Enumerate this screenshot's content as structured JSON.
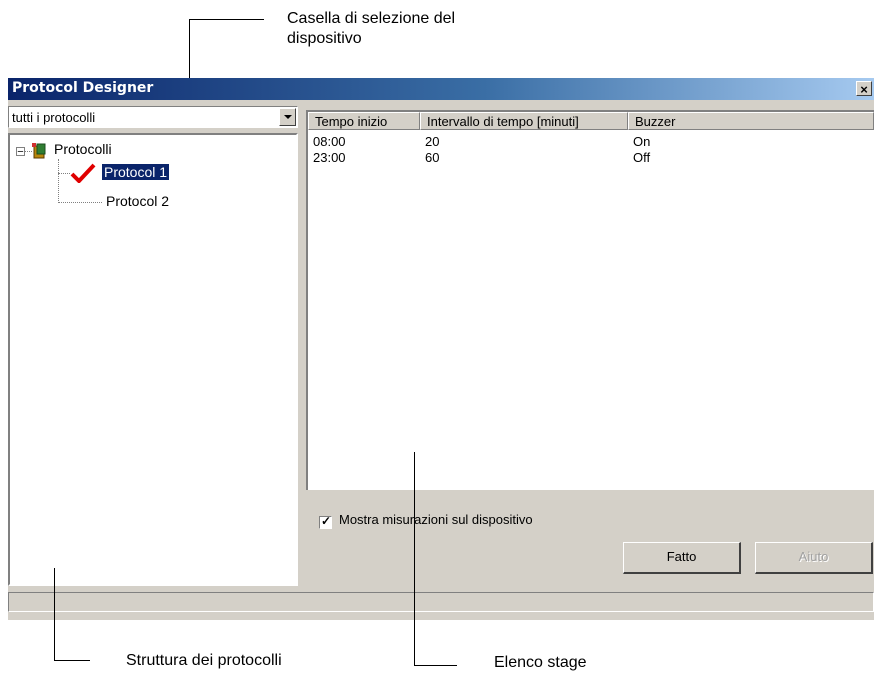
{
  "annotations": {
    "device_selector": "Casella di selezione del dispositivo",
    "device_selector_line2": "dispositivo",
    "device_selector_line1": "Casella di selezione del",
    "protocol_tree": "Struttura dei protocolli",
    "stage_list": "Elenco stage"
  },
  "window": {
    "title": "Protocol Designer",
    "close_label": "×"
  },
  "device_combo": {
    "selected": "tutti i protocolli"
  },
  "tree": {
    "root_label": "Protocolli",
    "items": [
      {
        "label": "Protocol 1",
        "selected": true,
        "checked": true
      },
      {
        "label": "Protocol 2",
        "selected": false,
        "checked": false
      }
    ],
    "root_icon": "protocol-folder-icon",
    "check_icon": "red-check-icon"
  },
  "stage_table": {
    "columns": [
      "Tempo inizio",
      "Intervallo di tempo [minuti]",
      "Buzzer"
    ],
    "rows": [
      [
        "08:00",
        "20",
        "On"
      ],
      [
        "23:00",
        "60",
        "Off"
      ]
    ]
  },
  "checkbox": {
    "label": "Mostra misurazioni sul dispositivo",
    "checked": true
  },
  "buttons": {
    "done": "Fatto",
    "help": "Aiuto"
  },
  "colors": {
    "title_gradient_start": "#0a246a",
    "title_gradient_end": "#a6caf0",
    "selection": "#0a246a",
    "check_mark": "#e00000"
  }
}
